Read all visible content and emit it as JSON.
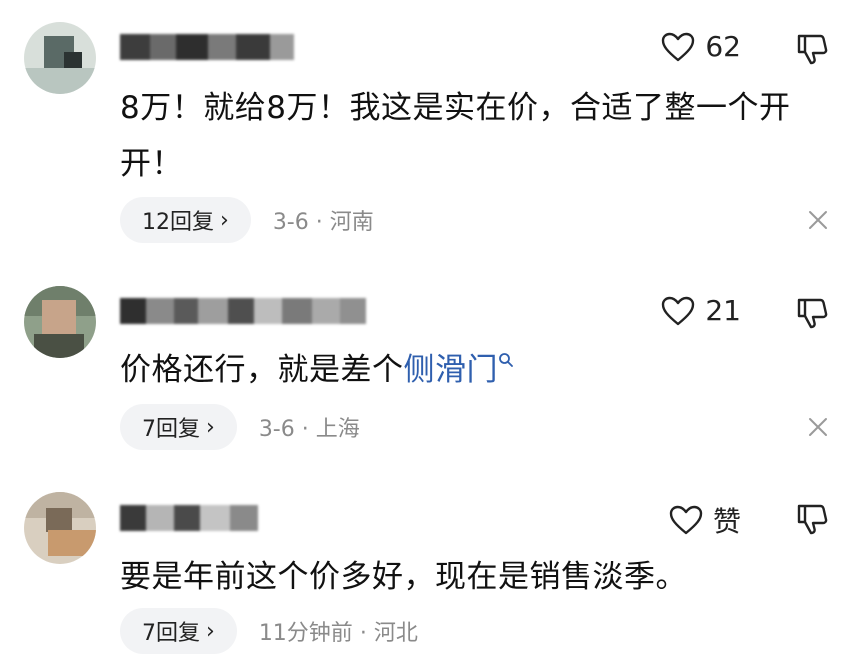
{
  "comments": [
    {
      "likes": "62",
      "text": "8万！就给8万！我这是实在价，合适了整一个开开！",
      "reply_label": "12回复",
      "date": "3-6",
      "location": "河南"
    },
    {
      "likes": "21",
      "text": "价格还行，就是差个",
      "link_text": "侧滑门",
      "reply_label": "7回复",
      "date": "3-6",
      "location": "上海"
    },
    {
      "likes": "赞",
      "text": "要是年前这个价多好，现在是销售淡季。",
      "reply_label": "7回复",
      "date": "11分钟前",
      "location": "河北"
    }
  ],
  "separator": "·",
  "chevron": "›",
  "icons": [
    "heart-icon",
    "thumbs-down-icon",
    "close-icon",
    "search-icon"
  ],
  "colors": {
    "link": "#2f5fae",
    "meta": "#8a8a8a",
    "pill": "#f2f3f5"
  }
}
